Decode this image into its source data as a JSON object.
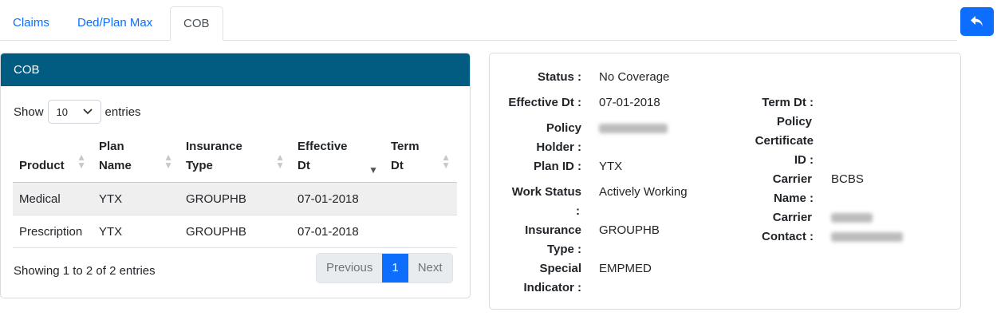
{
  "tabs": [
    {
      "label": "Claims"
    },
    {
      "label": "Ded/Plan Max"
    },
    {
      "label": "COB"
    }
  ],
  "active_tab": "COB",
  "back_button": {
    "icon": "reply-icon"
  },
  "cob_card": {
    "title": "COB",
    "show_label": "Show",
    "page_size": "10",
    "entries_label": "entries",
    "columns": [
      "Product",
      "Plan Name",
      "Insurance Type",
      "Effective Dt",
      "Term Dt"
    ],
    "rows": [
      {
        "product": "Medical",
        "plan_name": "YTX",
        "insurance_type": "GROUPHB",
        "effective_dt": "07-01-2018",
        "term_dt": ""
      },
      {
        "product": "Prescription",
        "plan_name": "YTX",
        "insurance_type": "GROUPHB",
        "effective_dt": "07-01-2018",
        "term_dt": ""
      }
    ],
    "info": "Showing 1 to 2 of 2 entries",
    "pagination": {
      "previous": "Previous",
      "current": "1",
      "next": "Next"
    }
  },
  "details": {
    "status_label": "Status :",
    "status_value": "No Coverage",
    "effective_label": "Effective Dt :",
    "effective_value": "07-01-2018",
    "policy_holder_label_1": "Policy",
    "policy_holder_label_2": "Holder :",
    "plan_id_label": "Plan ID :",
    "plan_id_value": "YTX",
    "work_status_label_1": "Work Status",
    "work_status_label_2": ":",
    "work_status_value": "Actively Working",
    "insurance_type_label_1": "Insurance",
    "insurance_type_label_2": "Type :",
    "insurance_type_value": "GROUPHB",
    "special_label_1": "Special",
    "special_label_2": "Indicator :",
    "special_value": "EMPMED",
    "term_label": "Term Dt :",
    "policy_cert_label_1": "Policy",
    "policy_cert_label_2": "Certificate",
    "policy_cert_label_3": "ID :",
    "carrier_name_label_1": "Carrier",
    "carrier_name_label_2": "Name :",
    "carrier_name_value": "BCBS",
    "carrier_contact_label_1": "Carrier",
    "carrier_contact_label_2": "Contact :"
  }
}
